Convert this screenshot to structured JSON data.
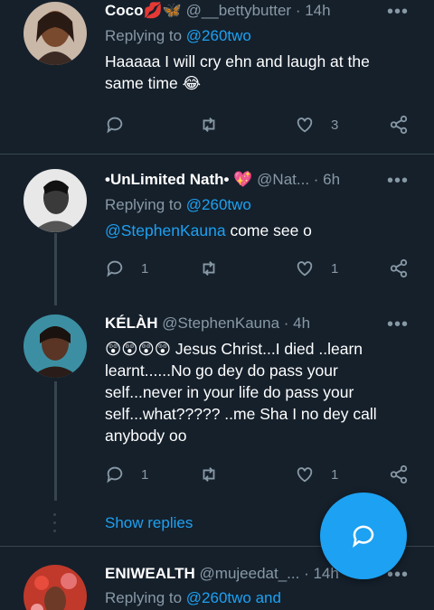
{
  "tweets": [
    {
      "name": "Coco",
      "name_emoji": "💋🦋",
      "handle": "@__bettybutter",
      "time": "· 14h",
      "replying_prefix": "Replying to ",
      "replying_to": "@260two",
      "text": "Haaaaa I will cry ehn and laugh at the same time 😂",
      "likes": "3"
    },
    {
      "name": "•UnLimited Nath•",
      "name_emoji": "💖",
      "handle": "@Nat...",
      "time": "· 6h",
      "replying_prefix": "Replying to ",
      "replying_to": "@260two",
      "mention": "@StephenKauna",
      "text": " come see o",
      "replies": "1",
      "likes": "1"
    },
    {
      "name": "KÉLÀH",
      "handle": "@StephenKauna",
      "time": "· 4h",
      "text": "😲😲😲😲 Jesus Christ...I died ..learn learnt......No go dey do pass your self...never in your life do pass your self...what????? ..me Sha I no dey call anybody oo",
      "replies": "1",
      "likes": "1"
    },
    {
      "name": "ENIWEALTH",
      "handle": "@mujeedat_...",
      "time": "· 14h",
      "replying_prefix": "Replying to ",
      "replying_to": "@260two and"
    }
  ],
  "show_replies": "Show replies",
  "more_glyph": "•••",
  "icons": [
    "reply-icon",
    "retweet-icon",
    "like-icon",
    "share-icon",
    "compose-reply-icon"
  ],
  "colors": {
    "background": "#15202b",
    "link": "#1da1f2",
    "secondary": "#8899a6",
    "divider": "#38444d"
  }
}
